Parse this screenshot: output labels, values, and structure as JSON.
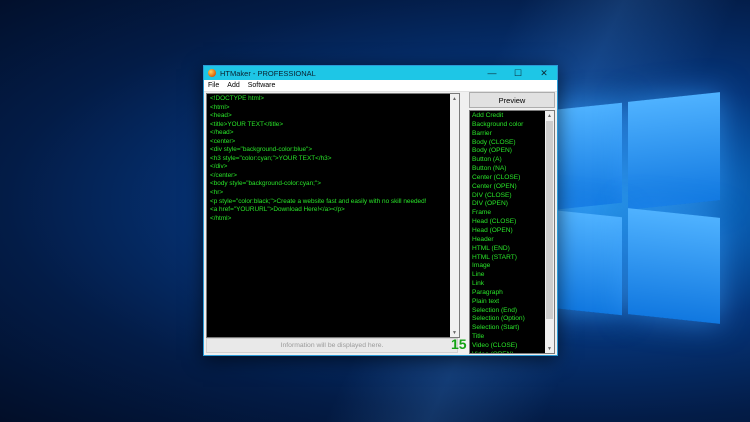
{
  "window": {
    "title": "HTMaker - PROFESSIONAL",
    "controls": {
      "minimize": "—",
      "maximize": "☐",
      "close": "✕"
    }
  },
  "menu": [
    "File",
    "Add",
    "Software"
  ],
  "editor": {
    "lines": [
      "<!DOCTYPE html>",
      "<html>",
      "<head>",
      "<title>YOUR TEXT</title>",
      "</head>",
      "<center>",
      "<div style=\"background-color:blue\">",
      "<h3 style=\"color:cyan;\">YOUR TEXT</h3>",
      "</div>",
      "</center>",
      "<body style=\"background-color:cyan;\">",
      "<hr>",
      "<p style=\"color:black;\">Create a website fast and easily with no skill needed!",
      "<a href=\"YOURURL\">Download Here!</a></p>",
      "</html>"
    ]
  },
  "preview_button": "Preview",
  "elements_list": [
    "Add Credit",
    "Background color",
    "Barrier",
    "Body (CLOSE)",
    "Body (OPEN)",
    "Button (A)",
    "Button (NA)",
    "Center (CLOSE)",
    "Center (OPEN)",
    "DIV (CLOSE)",
    "DIV (OPEN)",
    "Frame",
    "Head (CLOSE)",
    "Head (OPEN)",
    "Header",
    "HTML (END)",
    "HTML (START)",
    "Image",
    "Line",
    "Link",
    "Paragraph",
    "Plain text",
    "Selection (End)",
    "Selection (Option)",
    "Selection (Start)",
    "Title",
    "Video (CLOSE)",
    "Video (OPEN)"
  ],
  "status_text": "Information will be displayed here.",
  "line_count": "15",
  "colors": {
    "titlebar": "#1ec6e6",
    "code_text": "#29e629",
    "counter": "#13a313"
  }
}
